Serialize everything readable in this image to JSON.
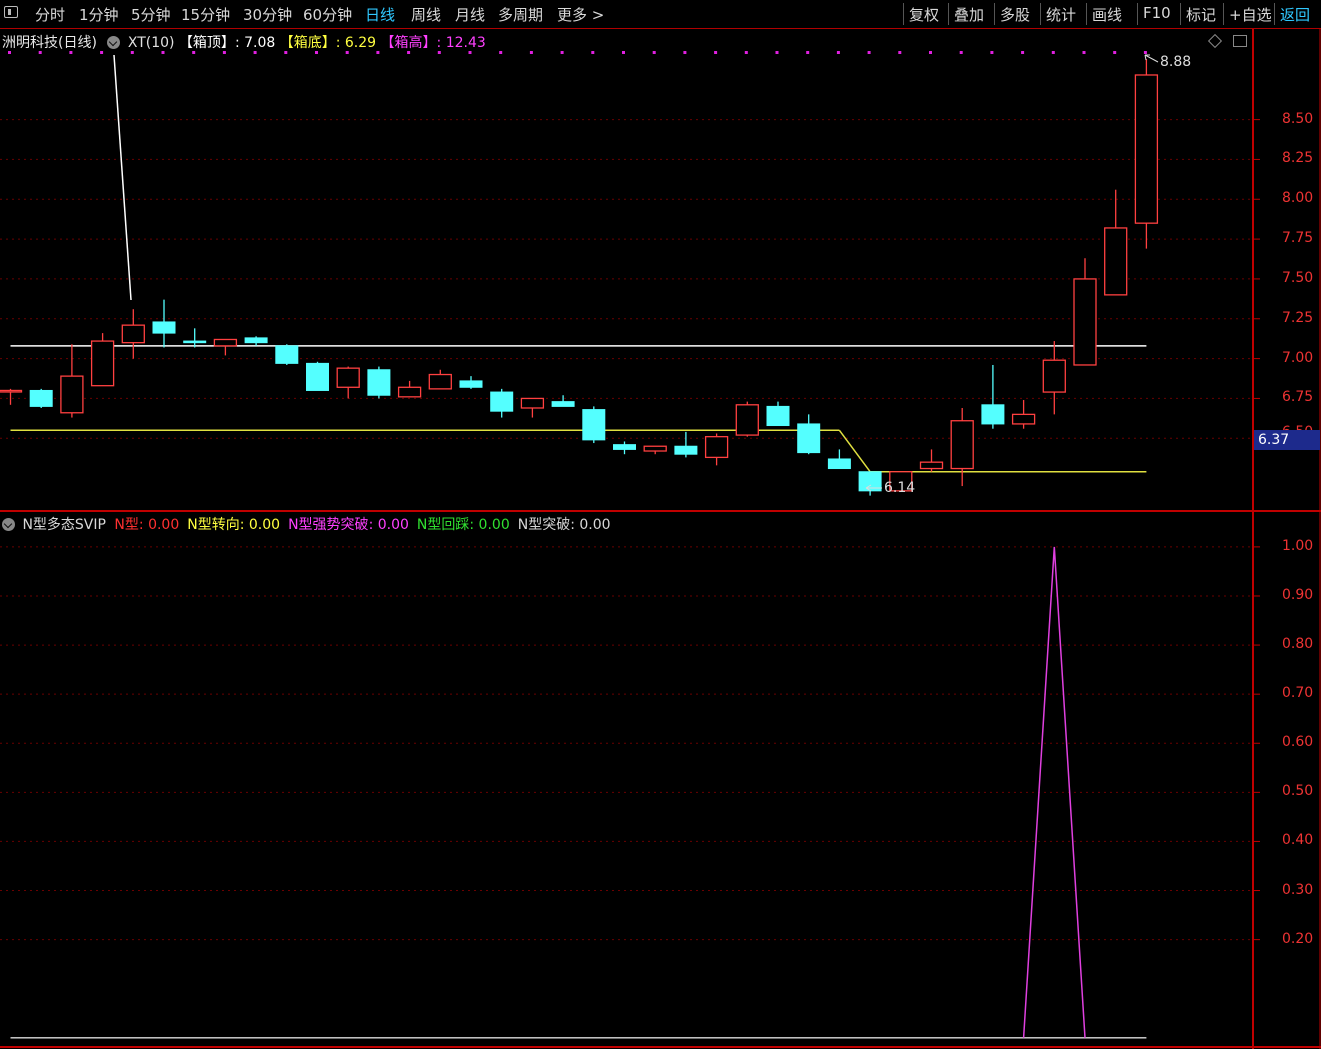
{
  "toolbar": {
    "periods": [
      "分时",
      "1分钟",
      "5分钟",
      "15分钟",
      "30分钟",
      "60分钟",
      "日线",
      "周线",
      "月线",
      "多周期",
      "更多 >"
    ],
    "active_period": "日线",
    "tools": [
      "复权",
      "叠加",
      "多股",
      "统计",
      "画线",
      "F10",
      "标记",
      "+自选",
      "返回"
    ]
  },
  "main_panel": {
    "stock_title": "洲明科技(日线)",
    "indicator_name": "XT(10)",
    "box_top_label": "【箱顶】",
    "box_top_value": ": 7.08",
    "box_bottom_label": "【箱底】",
    "box_bottom_value": ": 6.29",
    "box_high_label": "【箱高】",
    "box_high_value": ": 12.43",
    "high_marker": "8.88",
    "low_marker": "6.14",
    "current_price_tag": "6.37",
    "axis_labels": [
      "8.50",
      "8.25",
      "8.00",
      "7.75",
      "7.50",
      "7.25",
      "7.00",
      "6.75"
    ],
    "partial_axis_label": "6.50"
  },
  "sub_panel": {
    "indicator_name": "N型多态SVIP",
    "fields": [
      {
        "label": "N型",
        "value": ": 0.00",
        "color": "#ff3030"
      },
      {
        "label": "N型转向",
        "value": ": 0.00",
        "color": "#ffff40"
      },
      {
        "label": "N型强势突破",
        "value": ": 0.00",
        "color": "#ff40ff"
      },
      {
        "label": "N型回踩",
        "value": ": 0.00",
        "color": "#30e030"
      },
      {
        "label": "N型突破",
        "value": ": 0.00",
        "color": "#d8d8d8"
      }
    ],
    "axis_labels": [
      "1.00",
      "0.90",
      "0.80",
      "0.70",
      "0.60",
      "0.50",
      "0.40",
      "0.30",
      "0.20"
    ]
  },
  "colors": {
    "up_candle": "#ff4040",
    "down_candle": "#54ffff",
    "box_top_line": "#ffffff",
    "box_bottom_line": "#e0e040",
    "signal_line": "#e040e0",
    "grid": "#6a0000",
    "axis_text": "#ff3333"
  },
  "chart_data": {
    "type": "candlestick",
    "candles": [
      {
        "o": 6.8,
        "h": 6.81,
        "l": 6.71,
        "c": 6.8
      },
      {
        "o": 6.8,
        "h": 6.81,
        "l": 6.69,
        "c": 6.7
      },
      {
        "o": 6.66,
        "h": 7.09,
        "l": 6.63,
        "c": 6.89
      },
      {
        "o": 6.83,
        "h": 7.16,
        "l": 6.83,
        "c": 7.11
      },
      {
        "o": 7.1,
        "h": 7.31,
        "l": 7.0,
        "c": 7.21
      },
      {
        "o": 7.23,
        "h": 7.37,
        "l": 7.07,
        "c": 7.16
      },
      {
        "o": 7.11,
        "h": 7.19,
        "l": 7.07,
        "c": 7.1
      },
      {
        "o": 7.08,
        "h": 7.12,
        "l": 7.02,
        "c": 7.12
      },
      {
        "o": 7.13,
        "h": 7.14,
        "l": 7.08,
        "c": 7.1
      },
      {
        "o": 7.08,
        "h": 7.09,
        "l": 6.96,
        "c": 6.97
      },
      {
        "o": 6.97,
        "h": 6.98,
        "l": 6.8,
        "c": 6.8
      },
      {
        "o": 6.82,
        "h": 6.95,
        "l": 6.75,
        "c": 6.94
      },
      {
        "o": 6.93,
        "h": 6.95,
        "l": 6.75,
        "c": 6.77
      },
      {
        "o": 6.76,
        "h": 6.86,
        "l": 6.76,
        "c": 6.82
      },
      {
        "o": 6.81,
        "h": 6.93,
        "l": 6.81,
        "c": 6.9
      },
      {
        "o": 6.86,
        "h": 6.89,
        "l": 6.81,
        "c": 6.82
      },
      {
        "o": 6.79,
        "h": 6.81,
        "l": 6.63,
        "c": 6.67
      },
      {
        "o": 6.69,
        "h": 6.75,
        "l": 6.63,
        "c": 6.75
      },
      {
        "o": 6.73,
        "h": 6.77,
        "l": 6.7,
        "c": 6.7
      },
      {
        "o": 6.68,
        "h": 6.7,
        "l": 6.47,
        "c": 6.49
      },
      {
        "o": 6.46,
        "h": 6.48,
        "l": 6.4,
        "c": 6.43
      },
      {
        "o": 6.42,
        "h": 6.45,
        "l": 6.4,
        "c": 6.45
      },
      {
        "o": 6.45,
        "h": 6.54,
        "l": 6.38,
        "c": 6.4
      },
      {
        "o": 6.38,
        "h": 6.53,
        "l": 6.33,
        "c": 6.51
      },
      {
        "o": 6.52,
        "h": 6.73,
        "l": 6.51,
        "c": 6.71
      },
      {
        "o": 6.7,
        "h": 6.73,
        "l": 6.59,
        "c": 6.58
      },
      {
        "o": 6.59,
        "h": 6.65,
        "l": 6.4,
        "c": 6.41
      },
      {
        "o": 6.37,
        "h": 6.43,
        "l": 6.31,
        "c": 6.31
      },
      {
        "o": 6.29,
        "h": 6.29,
        "l": 6.14,
        "c": 6.17
      },
      {
        "o": 6.17,
        "h": 6.29,
        "l": 6.17,
        "c": 6.29
      },
      {
        "o": 6.31,
        "h": 6.43,
        "l": 6.29,
        "c": 6.35
      },
      {
        "o": 6.31,
        "h": 6.69,
        "l": 6.2,
        "c": 6.61
      },
      {
        "o": 6.71,
        "h": 6.96,
        "l": 6.56,
        "c": 6.59
      },
      {
        "o": 6.59,
        "h": 6.74,
        "l": 6.56,
        "c": 6.65
      },
      {
        "o": 6.79,
        "h": 7.11,
        "l": 6.65,
        "c": 6.99
      },
      {
        "o": 6.96,
        "h": 7.63,
        "l": 6.96,
        "c": 7.5
      },
      {
        "o": 7.4,
        "h": 8.06,
        "l": 7.4,
        "c": 7.82
      },
      {
        "o": 7.85,
        "h": 8.88,
        "l": 7.69,
        "c": 8.78
      }
    ],
    "box_top": 7.08,
    "box_bottom_segments": [
      {
        "from_bar": 0,
        "to_bar": 27,
        "value": 6.55
      },
      {
        "from_bar": 27,
        "to_bar": 28,
        "value_start": 6.55,
        "value_end": 6.29
      },
      {
        "from_bar": 28,
        "to_bar": 37,
        "value": 6.29
      }
    ],
    "signal_series": {
      "name": "N型强势突破",
      "peak_bar": 34,
      "peak_value": 1.0,
      "base_value": 0.0
    },
    "price_range": [
      6.1,
      9.1
    ],
    "signal_range": [
      0.0,
      1.1
    ]
  }
}
